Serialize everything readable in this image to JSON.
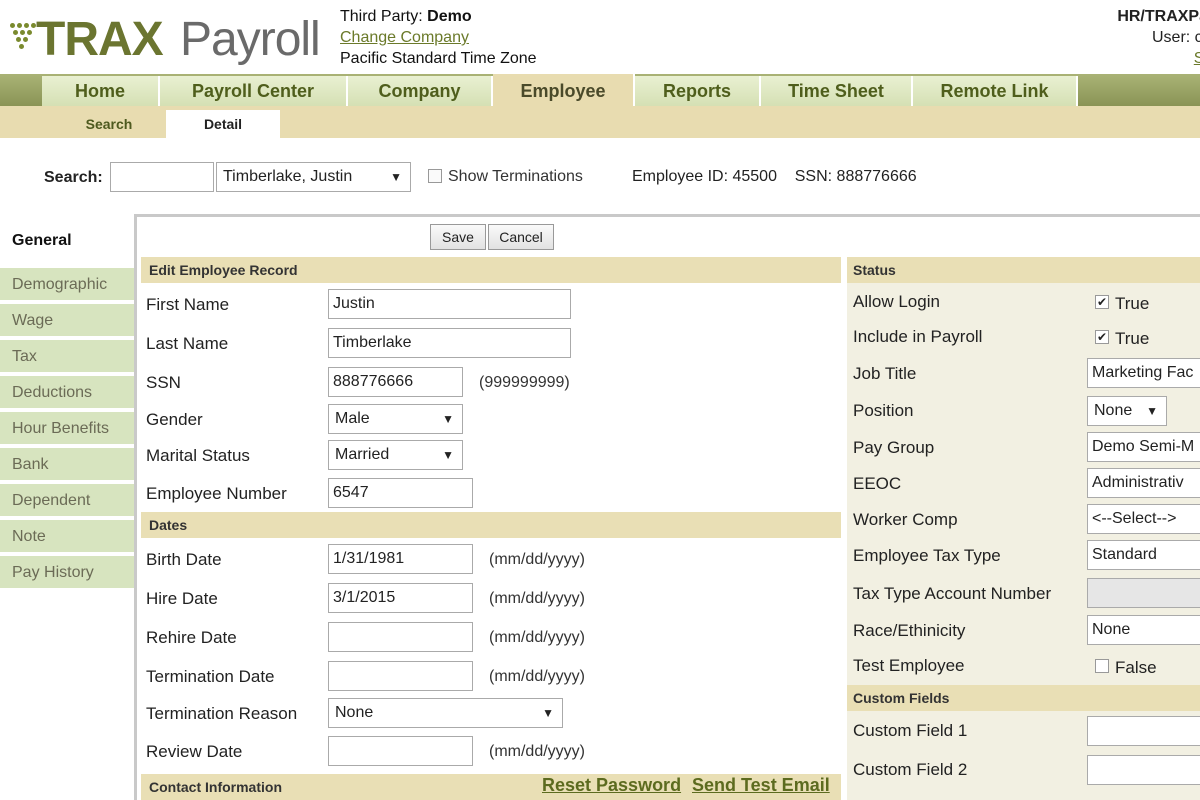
{
  "app": {
    "logo_strong": "TRAX",
    "logo_light": "Payroll",
    "logo_icon": "grape-cluster-icon"
  },
  "header": {
    "third_party_label": "Third Party:",
    "third_party_value": "Demo",
    "change_company": "Change Company",
    "timezone": "Pacific Standard Time Zone",
    "hr_label": "HR/TRAXPa",
    "user_label": "User: cr",
    "signout_label": "Si"
  },
  "nav": {
    "tabs": [
      {
        "label": "Home",
        "active": false
      },
      {
        "label": "Payroll Center",
        "active": false
      },
      {
        "label": "Company",
        "active": false
      },
      {
        "label": "Employee",
        "active": true
      },
      {
        "label": "Reports",
        "active": false
      },
      {
        "label": "Time Sheet",
        "active": false
      },
      {
        "label": "Remote Link",
        "active": false
      }
    ]
  },
  "subnav": {
    "tabs": [
      {
        "label": "Search",
        "active": false
      },
      {
        "label": "Detail",
        "active": true
      }
    ]
  },
  "search": {
    "label": "Search:",
    "input_value": "",
    "employee_selected": "Timberlake, Justin",
    "show_terminations": "Show Terminations",
    "show_terminations_checked": false,
    "employee_id_text": "Employee ID: 45500    SSN: 888776666"
  },
  "sidebar": {
    "items": [
      {
        "label": "General",
        "active": true
      },
      {
        "label": "Demographic",
        "active": false
      },
      {
        "label": "Wage",
        "active": false
      },
      {
        "label": "Tax",
        "active": false
      },
      {
        "label": "Deductions",
        "active": false
      },
      {
        "label": "Hour Benefits",
        "active": false
      },
      {
        "label": "Bank",
        "active": false
      },
      {
        "label": "Dependent",
        "active": false
      },
      {
        "label": "Note",
        "active": false
      },
      {
        "label": "Pay History",
        "active": false
      }
    ]
  },
  "toolbar": {
    "save_label": "Save",
    "cancel_label": "Cancel"
  },
  "edit_record": {
    "heading": "Edit Employee Record",
    "first_name_label": "First Name",
    "first_name_value": "Justin",
    "last_name_label": "Last Name",
    "last_name_value": "Timberlake",
    "ssn_label": "SSN",
    "ssn_value": "888776666",
    "ssn_hint": "(999999999)",
    "gender_label": "Gender",
    "gender_value": "Male",
    "marital_label": "Marital Status",
    "marital_value": "Married",
    "emp_number_label": "Employee Number",
    "emp_number_value": "6547"
  },
  "dates": {
    "heading": "Dates",
    "birth_label": "Birth Date",
    "birth_value": "1/31/1981",
    "hire_label": "Hire Date",
    "hire_value": "3/1/2015",
    "rehire_label": "Rehire Date",
    "rehire_value": "",
    "term_label": "Termination Date",
    "term_value": "",
    "term_reason_label": "Termination Reason",
    "term_reason_value": "None",
    "review_label": "Review Date",
    "review_value": "",
    "date_hint": "(mm/dd/yyyy)"
  },
  "contact": {
    "heading": "Contact Information",
    "reset_password": "Reset Password",
    "send_test_email": "Send Test Email"
  },
  "status": {
    "heading": "Status",
    "allow_login_label": "Allow Login",
    "allow_login_value": "True",
    "include_payroll_label": "Include in Payroll",
    "include_payroll_value": "True",
    "job_title_label": "Job Title",
    "job_title_value": "Marketing Fac",
    "position_label": "Position",
    "position_value": "None",
    "pay_group_label": "Pay Group",
    "pay_group_value": "Demo Semi-M",
    "eeoc_label": "EEOC",
    "eeoc_value": "Administrativ",
    "worker_comp_label": "Worker Comp",
    "worker_comp_value": "<--Select-->",
    "tax_type_label": "Employee Tax Type",
    "tax_type_value": "Standard",
    "tax_account_label": "Tax Type Account Number",
    "tax_account_value": "",
    "race_label": "Race/Ethinicity",
    "race_value": "None",
    "test_employee_label": "Test Employee",
    "test_employee_value": "False"
  },
  "custom": {
    "heading": "Custom Fields",
    "field1_label": "Custom Field 1",
    "field1_value": "",
    "field2_label": "Custom Field 2",
    "field2_value": ""
  },
  "colors": {
    "brand_olive": "#6b7530",
    "nav_green": "#d5e0b4",
    "section_tan": "#e9dfb5"
  }
}
